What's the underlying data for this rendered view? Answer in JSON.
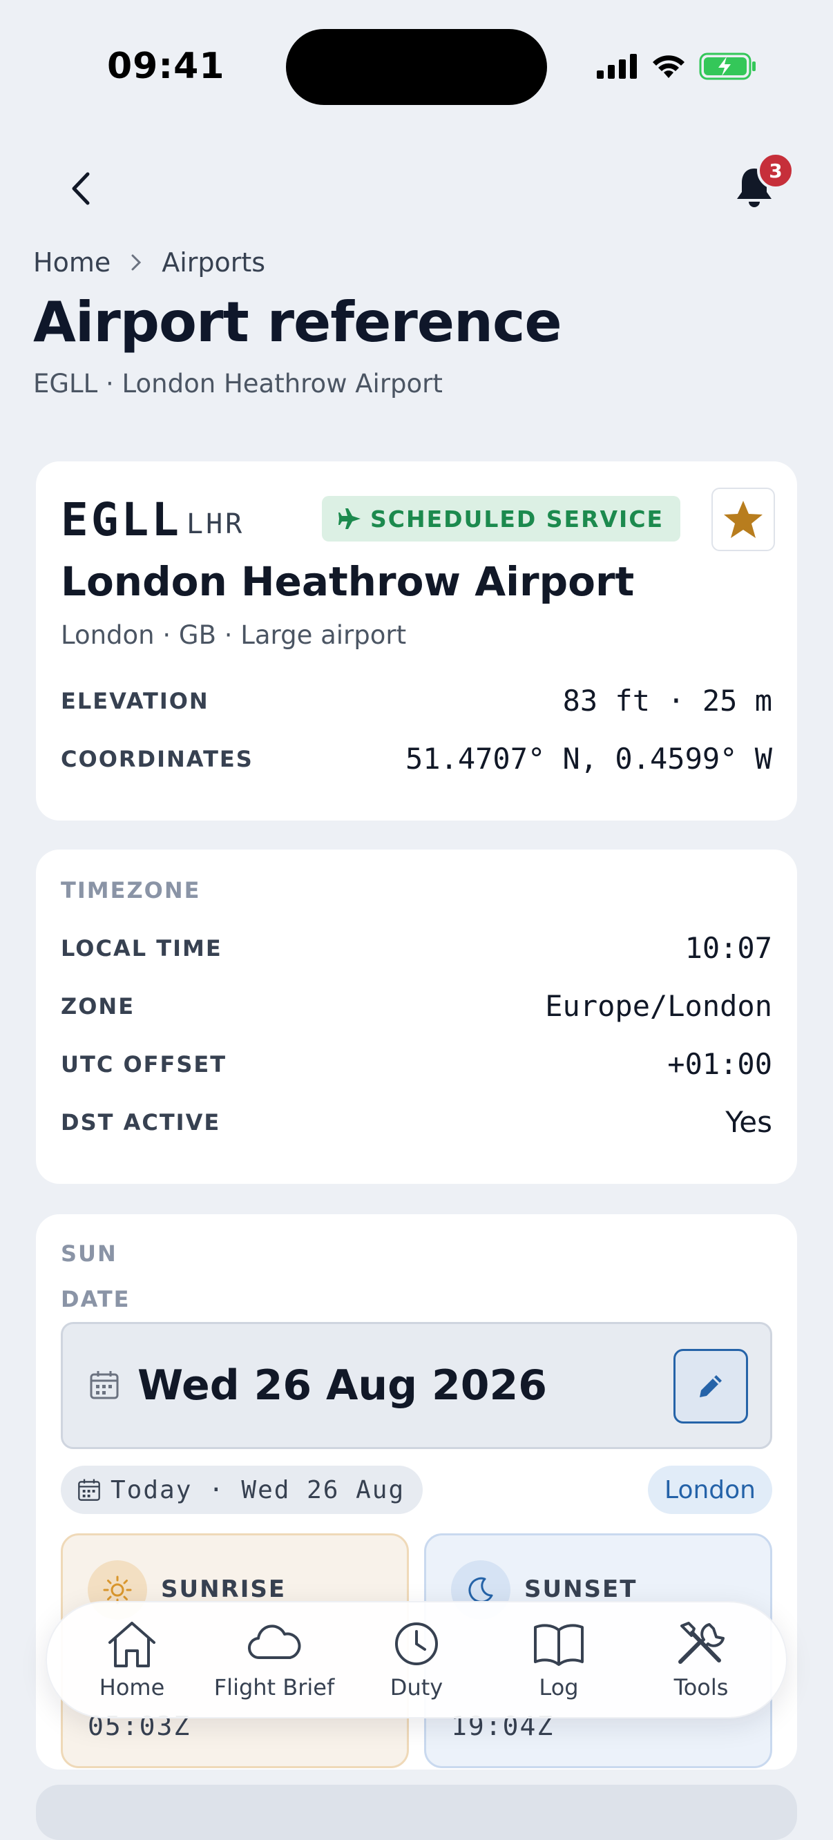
{
  "status_bar": {
    "time": "09:41"
  },
  "nav": {
    "notification_count": "3"
  },
  "breadcrumb": {
    "home": "Home",
    "current": "Airports"
  },
  "page": {
    "title": "Airport reference",
    "subtitle": "EGLL · London Heathrow Airport"
  },
  "airport": {
    "icao": "EGLL",
    "iata": "LHR",
    "service_chip": "SCHEDULED SERVICE",
    "name": "London Heathrow Airport",
    "meta": "London · GB · Large airport",
    "elevation_label": "ELEVATION",
    "elevation_value": "83 ft · 25 m",
    "coordinates_label": "COORDINATES",
    "coordinates_value": "51.4707° N, 0.4599° W",
    "accent_color": "#b87d1e"
  },
  "timezone": {
    "section_label": "TIMEZONE",
    "local_time_label": "LOCAL TIME",
    "local_time_value": "10:07",
    "zone_label": "ZONE",
    "zone_value": "Europe/London",
    "utc_offset_label": "UTC OFFSET",
    "utc_offset_value": "+01:00",
    "dst_label": "DST ACTIVE",
    "dst_value": "Yes"
  },
  "sun": {
    "section_label": "SUN",
    "date_label": "DATE",
    "date_value": "Wed 26 Aug 2026",
    "today_chip": "Today · Wed 26 Aug",
    "timezone_chip": "London",
    "sunrise_label": "SUNRISE",
    "sunrise_time": "05:03Z",
    "sunset_label": "SUNSET",
    "sunset_time": "19:04Z"
  },
  "tab_bar": {
    "items": [
      {
        "label": "Home",
        "icon": "home-icon"
      },
      {
        "label": "Flight Brief",
        "icon": "cloud-icon"
      },
      {
        "label": "Duty",
        "icon": "clock-icon"
      },
      {
        "label": "Log",
        "icon": "book-icon"
      },
      {
        "label": "Tools",
        "icon": "tools-icon"
      }
    ]
  },
  "colors": {
    "background": "#edf0f5",
    "success": "#1c8a4e",
    "link": "#2462a8",
    "badge": "#c62f3a"
  }
}
